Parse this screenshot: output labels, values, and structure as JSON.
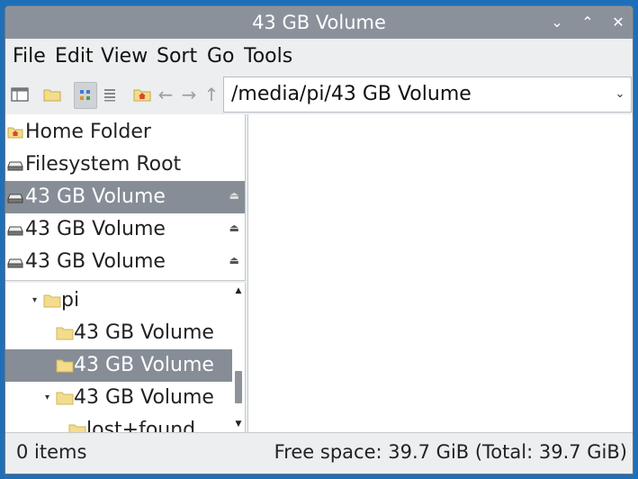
{
  "window": {
    "title": "43 GB Volume",
    "controls": {
      "minimize": "⌄",
      "maximize": "⌃",
      "close": "✕"
    }
  },
  "menubar": {
    "items": [
      "File",
      "Edit",
      "View",
      "Sort",
      "Go",
      "Tools"
    ]
  },
  "toolbar": {
    "tools": [
      "new-window-icon",
      "new-folder-icon",
      "icon-view-icon",
      "list-view-icon",
      "home-icon",
      "back-icon",
      "forward-icon",
      "up-icon"
    ],
    "arrows": {
      "back": "←",
      "forward": "→",
      "up": "↑"
    },
    "location": "/media/pi/43 GB Volume",
    "location_dropdown": "⌄"
  },
  "places": [
    {
      "label": "Home Folder",
      "icon": "home-folder-icon",
      "selected": false,
      "eject": ""
    },
    {
      "label": "Filesystem Root",
      "icon": "drive-icon",
      "selected": false,
      "eject": ""
    },
    {
      "label": "43 GB Volume",
      "icon": "drive-icon",
      "selected": true,
      "eject": "⏏"
    },
    {
      "label": "43 GB Volume",
      "icon": "drive-icon",
      "selected": false,
      "eject": "⏏"
    },
    {
      "label": "43 GB Volume",
      "icon": "drive-icon",
      "selected": false,
      "eject": "⏏"
    }
  ],
  "tree": [
    {
      "label": "pi",
      "expander": "▾",
      "selected": false
    },
    {
      "label": "43 GB Volume",
      "expander": "",
      "selected": false
    },
    {
      "label": "43 GB Volume",
      "expander": "",
      "selected": true
    },
    {
      "label": "43 GB Volume",
      "expander": "▾",
      "selected": false
    },
    {
      "label": "lost+found",
      "expander": "",
      "selected": false
    }
  ],
  "scrollbar": {
    "up": "▲",
    "down": "▼"
  },
  "status": {
    "items": "0 items",
    "free_space": "Free space: 39.7 GiB (Total: 39.7 GiB)"
  },
  "colors": {
    "titlebar": "#8a919b",
    "selection": "#868d96",
    "folder": "#f3dc8c",
    "desktop": "#1f6fb8"
  }
}
